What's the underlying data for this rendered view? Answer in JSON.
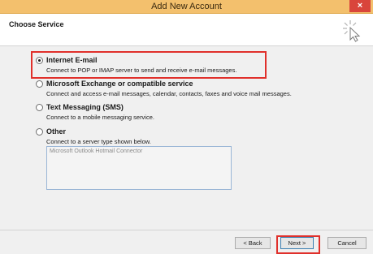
{
  "window": {
    "title": "Add New Account",
    "close_glyph": "×"
  },
  "header": {
    "page_title": "Choose Service",
    "icon": "cursor-click-icon"
  },
  "options": [
    {
      "label": "Internet E-mail",
      "description": "Connect to POP or IMAP server to send and receive e-mail messages.",
      "selected": true
    },
    {
      "label": "Microsoft Exchange or compatible service",
      "description": "Connect and access e-mail messages, calendar, contacts, faxes and voice mail messages.",
      "selected": false
    },
    {
      "label": "Text Messaging (SMS)",
      "description": "Connect to a mobile messaging service.",
      "selected": false
    },
    {
      "label": "Other",
      "description": "Connect to a server type shown below.",
      "selected": false
    }
  ],
  "connector_list": {
    "items": [
      "Microsoft Outlook Hotmail Connector"
    ]
  },
  "footer": {
    "back_label": "< Back",
    "next_label": "Next >",
    "cancel_label": "Cancel"
  },
  "colors": {
    "titlebar": "#f3c06d",
    "highlight": "#e0302b",
    "close_button": "#d9453b"
  }
}
